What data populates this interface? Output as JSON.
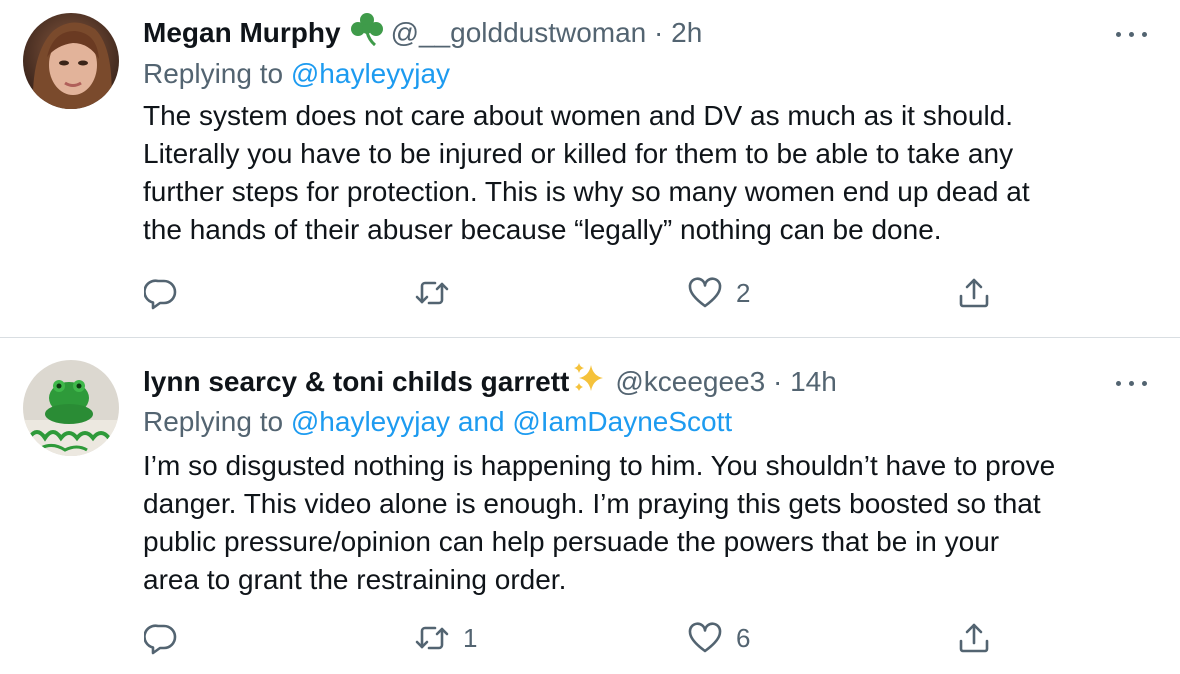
{
  "tweets": [
    {
      "name": "Megan Murphy",
      "name_emoji": "shamrock-icon",
      "handle": "@__golddustwoman",
      "separator": "·",
      "time": "2h",
      "replying_prefix": "Replying to",
      "replying_to": "@hayleyyjay",
      "replying_joiner": "",
      "replying_to_2": "",
      "text_lines": [
        "The system does not care about women and DV as much as it should.",
        "Literally you have to be injured or killed for them to be able to take any",
        "further steps for protection. This is why so many women end up dead at",
        "the hands of their abuser because “legally” nothing can be done."
      ],
      "actions": {
        "reply_count": "",
        "retweet_count": "",
        "like_count": "2"
      }
    },
    {
      "name": "lynn searcy & toni childs garrett",
      "name_emoji": "sparkles-icon",
      "handle": "@kceegee3",
      "separator": "·",
      "time": "14h",
      "replying_prefix": "Replying to",
      "replying_to": "@hayleyyjay",
      "replying_joiner": "and",
      "replying_to_2": "@IamDayneScott",
      "text_lines": [
        "I’m so disgusted nothing is happening to him. You shouldn’t have to prove",
        "danger. This video alone is enough. I’m praying this gets boosted so that",
        "public pressure/opinion can help persuade the powers that be in your",
        "area to grant the restraining order."
      ],
      "actions": {
        "reply_count": "",
        "retweet_count": "1",
        "like_count": "6"
      }
    }
  ],
  "colors": {
    "text": "#0f1419",
    "secondary": "#536471",
    "link": "#1d9bf0",
    "divider": "#d9dee2",
    "shamrock": "#3f9b4a",
    "sparkles": "#f5c23b"
  }
}
